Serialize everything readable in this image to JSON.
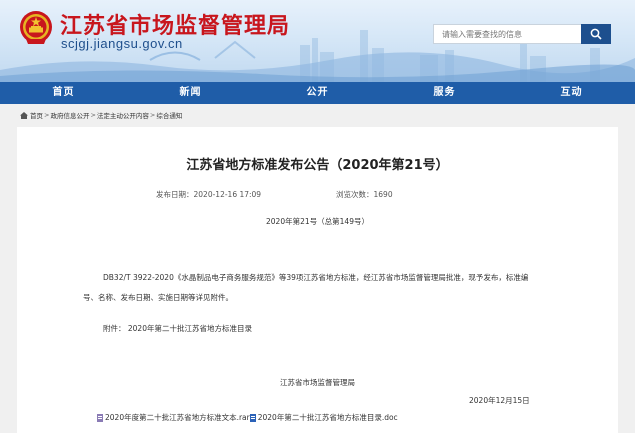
{
  "header": {
    "site_title": "江苏省市场监督管理局",
    "site_domain": "scjgj.jiangsu.gov.cn",
    "emblem_icon": "national-emblem-icon",
    "search_placeholder": "请输入需要查找的信息",
    "search_icon": "search-icon"
  },
  "nav": {
    "items": [
      {
        "label": "首页"
      },
      {
        "label": "新闻"
      },
      {
        "label": "公开"
      },
      {
        "label": "服务"
      },
      {
        "label": "互动"
      }
    ]
  },
  "breadcrumb": {
    "home_icon": "home-icon",
    "items": [
      {
        "label": "首页"
      },
      {
        "label": "政府信息公开"
      },
      {
        "label": "法定主动公开内容"
      },
      {
        "label": "综合通知"
      }
    ],
    "separator": ">"
  },
  "article": {
    "title": "江苏省地方标准发布公告（2020年第21号）",
    "publish_date": "发布日期：2020-12-16 17:09",
    "views": "浏览次数：1690",
    "doc_number": "2020年第21号（总第149号）",
    "paragraph_line1": "DB32/T 3922-2020《水晶制品电子商务服务规范》等39项江苏省地方标准，经江苏省市场监督管理局批准，现予发布，标准编",
    "paragraph_line2": "号、名称、发布日期、实施日期等详见附件。",
    "attachment_line": "附件：  2020年第二十批江苏省地方标准目录",
    "signature": "江苏省市场监督管理局",
    "sign_date": "2020年12月15日",
    "files": [
      {
        "name": "2020年度第二十批江苏省地方标准文本.rar",
        "icon": "rar-file-icon"
      },
      {
        "name": "2020年第二十批江苏省地方标准目录.doc",
        "icon": "doc-file-icon"
      }
    ]
  },
  "colors": {
    "title_red": "#c8161d",
    "nav_blue": "#1f5da8",
    "search_button": "#1d4f8e",
    "page_bg": "#f0f0f0"
  }
}
